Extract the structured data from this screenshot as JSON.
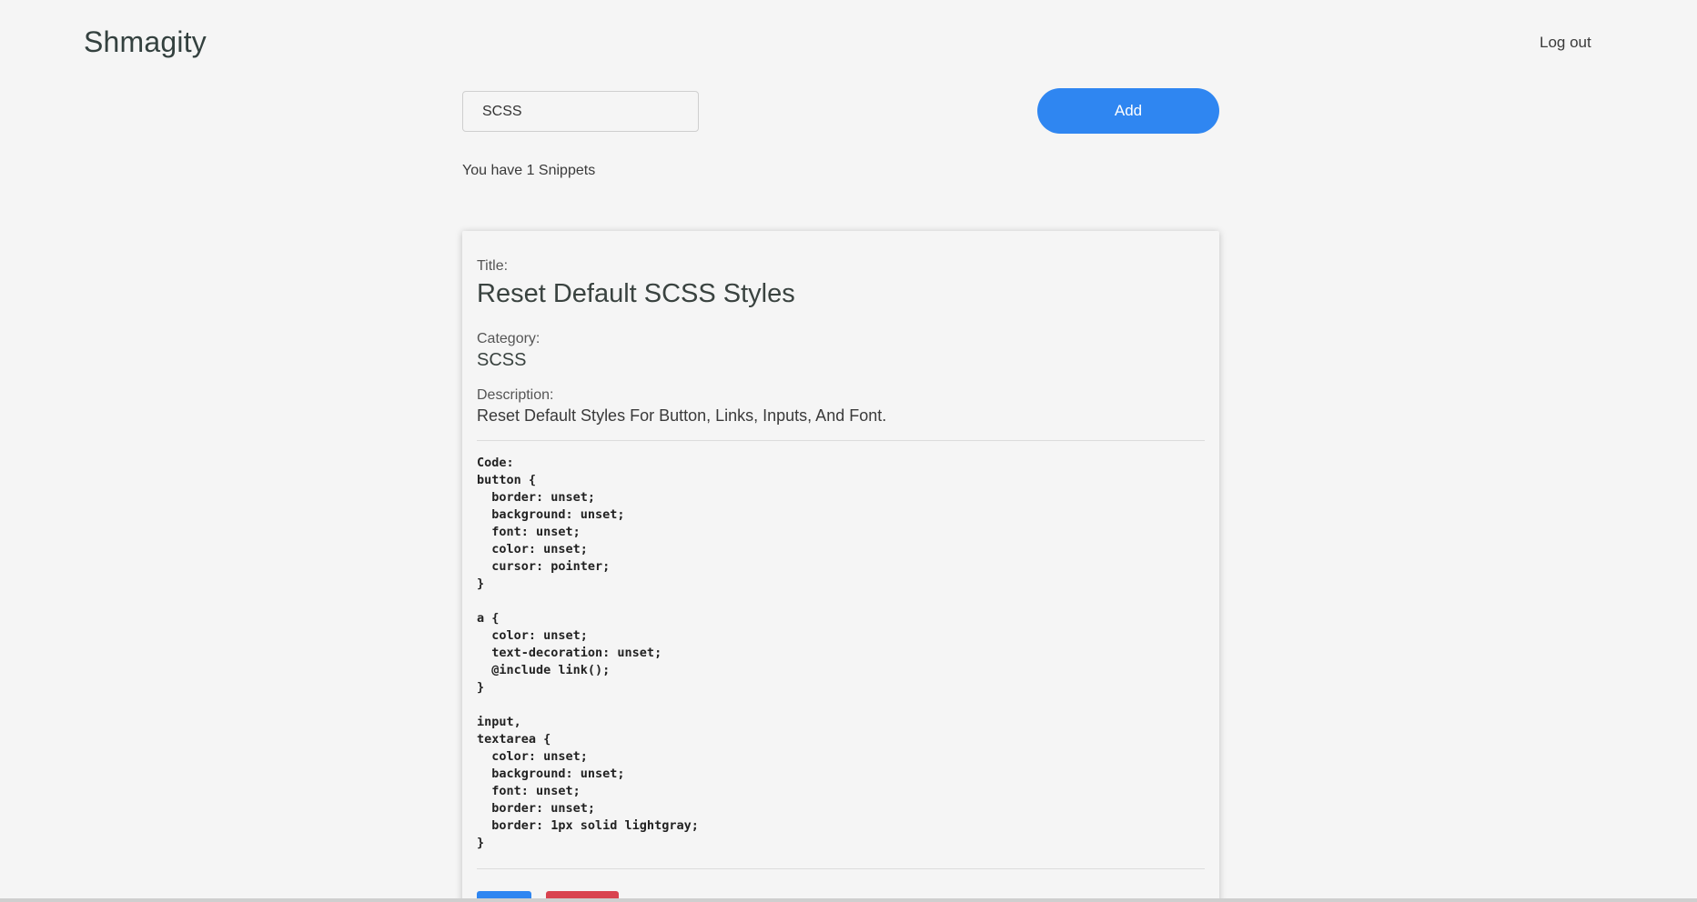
{
  "header": {
    "brand": "Shmagity",
    "logout_label": "Log out"
  },
  "toolbar": {
    "search_value": "SCSS",
    "add_label": "Add"
  },
  "snippets_count_text": "You have 1 Snippets",
  "snippet": {
    "title_label": "Title:",
    "title": "Reset Default SCSS Styles",
    "category_label": "Category:",
    "category": "SCSS",
    "description_label": "Description:",
    "description": "Reset Default Styles For Button, Links, Inputs, And Font.",
    "code": "Code:\nbutton {\n  border: unset;\n  background: unset;\n  font: unset;\n  color: unset;\n  cursor: pointer;\n}\n\na {\n  color: unset;\n  text-decoration: unset;\n  @include link();\n}\n\ninput,\ntextarea {\n  color: unset;\n  background: unset;\n  font: unset;\n  border: unset;\n  border: 1px solid lightgray;\n}"
  },
  "colors": {
    "accent": "#2f86f1",
    "danger": "#d9434f",
    "background": "#f5f5f5"
  }
}
